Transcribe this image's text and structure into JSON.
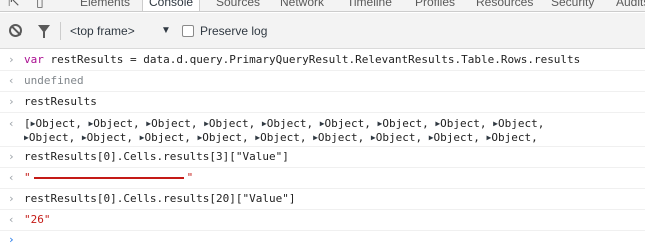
{
  "tabs": {
    "items": [
      "Elements",
      "Console",
      "Sources",
      "Network",
      "Timeline",
      "Profiles",
      "Resources",
      "Security",
      "Audits"
    ],
    "active": "Console"
  },
  "toolbar": {
    "frame_select": "<top frame>",
    "preserve_log_label": "Preserve log",
    "preserve_log_checked": false
  },
  "console": {
    "line1": {
      "keyword": "var",
      "code": " restResults = data.d.query.PrimaryQueryResult.RelevantResults.Table.Rows.results"
    },
    "line2": {
      "result": "undefined"
    },
    "line3": {
      "code": "restResults"
    },
    "line4": {
      "open_bracket": "[",
      "object_label": "Object,"
    },
    "line5": {
      "code": "restResults[0].Cells.results[3][\"Value\"]"
    },
    "line6": {
      "quote_open": "\"",
      "quote_close": "\""
    },
    "line7": {
      "code": "restResults[0].Cells.results[20][\"Value\"]"
    },
    "line8": {
      "result": "\"26\""
    }
  }
}
